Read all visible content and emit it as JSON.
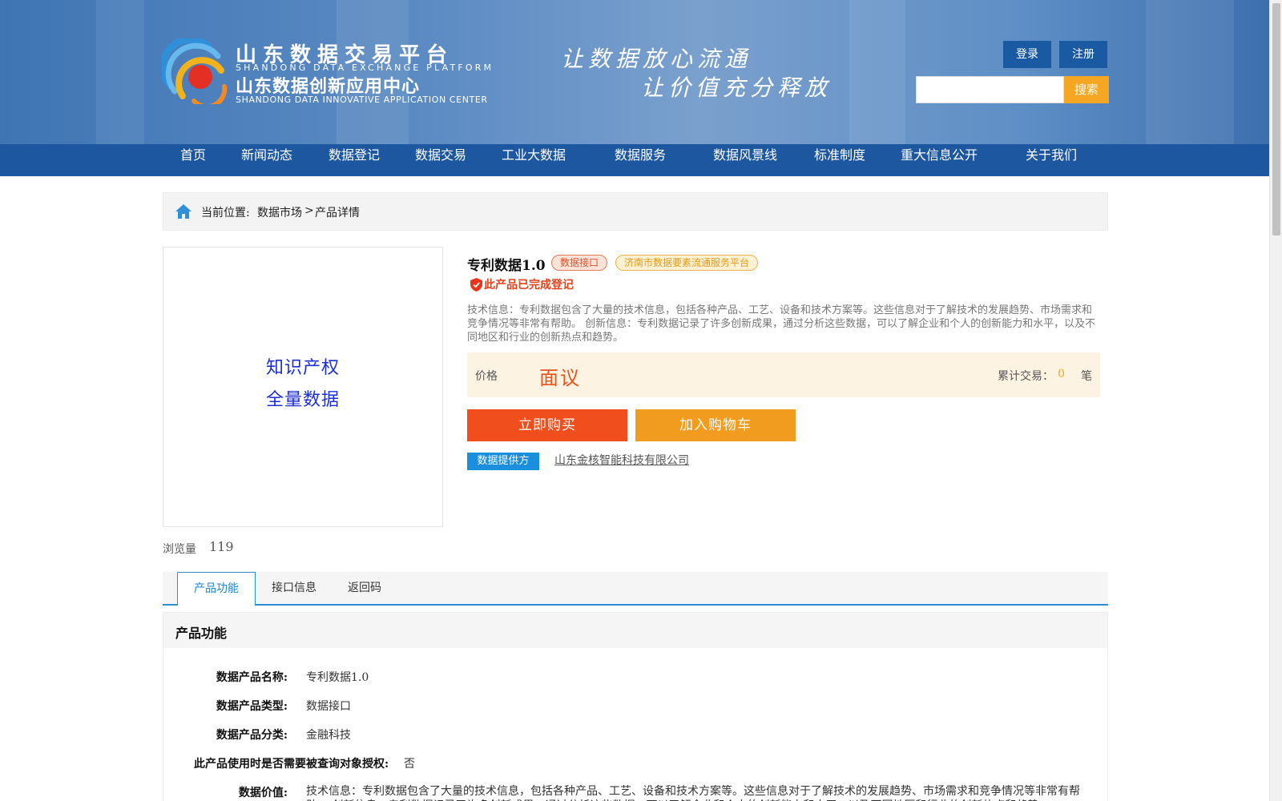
{
  "header": {
    "logo_cn": "山东数据交易平台",
    "logo_en": "SHANDONG DATA EXCHANGE PLATFORM",
    "logo_cn2": "山东数据创新应用中心",
    "logo_en2": "SHANDONG DATA INNOVATIVE APPLICATION CENTER",
    "slogan_line1": "让数据放心流通",
    "slogan_line2": "让价值充分释放",
    "login_label": "登录",
    "register_label": "注册",
    "search_placeholder": "",
    "search_label": "搜索"
  },
  "nav": {
    "items": [
      {
        "label": "首页"
      },
      {
        "label": "新闻动态"
      },
      {
        "label": "数据登记"
      },
      {
        "label": "数据交易"
      },
      {
        "label": "工业大数据"
      },
      {
        "label": "数据服务"
      },
      {
        "label": "数据风景线"
      },
      {
        "label": "标准制度"
      },
      {
        "label": "重大信息公开"
      },
      {
        "label": "关于我们"
      }
    ]
  },
  "breadcrumb": {
    "label": "当前位置:",
    "market": "数据市场",
    "sep": ">",
    "current": "产品详情"
  },
  "product": {
    "image_line1": "知识产权",
    "image_line2": "全量数据",
    "views_label": "浏览量",
    "views": "119",
    "title": "专利数据1.0",
    "tag_type": "数据接口",
    "tag_platform": "济南市数据要素流通服务平台",
    "registered": "此产品已完成登记",
    "description": "技术信息：专利数据包含了大量的技术信息，包括各种产品、工艺、设备和技术方案等。这些信息对于了解技术的发展趋势、市场需求和竞争情况等非常有帮助。 创新信息：专利数据记录了许多创新成果，通过分析这些数据，可以了解企业和个人的创新能力和水平，以及不同地区和行业的创新热点和趋势。",
    "price_label": "价格",
    "price": "面议",
    "trade_label": "累计交易：",
    "trade_count": "0",
    "trade_unit": "笔",
    "buy_label": "立即购买",
    "cart_label": "加入购物车",
    "provider_tag": "数据提供方",
    "provider_name": "山东金核智能科技有限公司"
  },
  "tabs": [
    {
      "label": "产品功能",
      "active": true
    },
    {
      "label": "接口信息",
      "active": false
    },
    {
      "label": "返回码",
      "active": false
    }
  ],
  "details": {
    "section_title": "产品功能",
    "rows": [
      {
        "label": "数据产品名称:",
        "value": "专利数据1.0"
      },
      {
        "label": "数据产品类型:",
        "value": "数据接口"
      },
      {
        "label": "数据产品分类:",
        "value": "金融科技"
      },
      {
        "label": "此产品使用时是否需要被查询对象授权:",
        "value": "否"
      },
      {
        "label": "数据价值:",
        "value": "技术信息：专利数据包含了大量的技术信息，包括各种产品、工艺、设备和技术方案等。这些信息对于了解技术的发展趋势、市场需求和竞争情况等非常有帮助。 创新信息：专利数据记录了许多创新成果，通过分析这些数据，可以了解企业和个人的创新能力和水平，以及不同地区和行业的创新热点和趋势。"
      }
    ]
  },
  "colors": {
    "nav_bg": "#1c57a0",
    "buy": "#f04e1c",
    "cart": "#f29c1f",
    "search_btn": "#f5a623",
    "tab_accent": "#2a8fd3"
  }
}
